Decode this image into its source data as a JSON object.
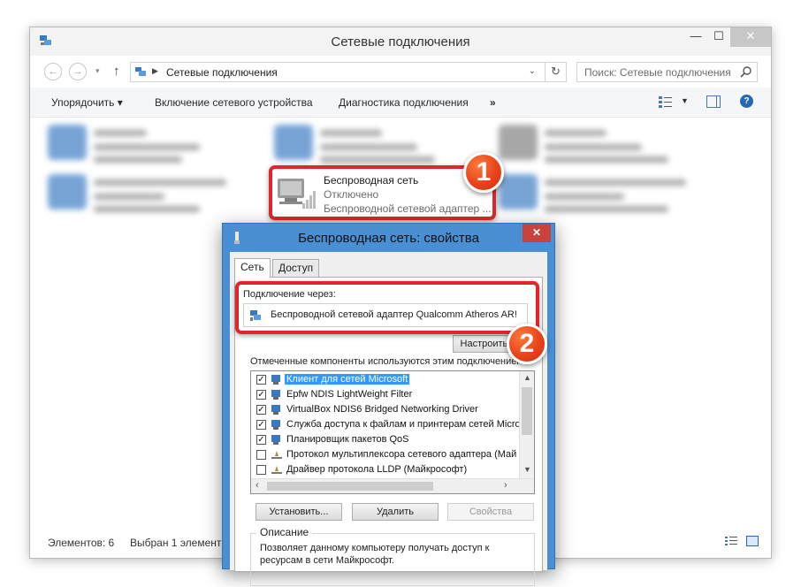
{
  "window": {
    "title": "Сетевые подключения",
    "min": "—",
    "max": "☐",
    "close": "✕"
  },
  "address": {
    "crumb": "Сетевые подключения",
    "search_placeholder": "Поиск: Сетевые подключения"
  },
  "toolbar": {
    "organize": "Упорядочить ▾",
    "enable": "Включение сетевого устройства",
    "diagnostics": "Диагностика подключения",
    "more": "»",
    "help": "?"
  },
  "network_item": {
    "name": "Беспроводная сеть",
    "status": "Отключено",
    "device": "Беспроводной сетевой адаптер ..."
  },
  "statusbar": {
    "count": "Элементов: 6",
    "selected": "Выбран 1 элемент"
  },
  "badges": {
    "one": "1",
    "two": "2"
  },
  "dialog": {
    "title": "Беспроводная сеть: свойства",
    "close": "✕",
    "tabs": [
      "Сеть",
      "Доступ"
    ],
    "connect_via_label": "Подключение через:",
    "adapter_name": "Беспроводной сетевой адаптер Qualcomm Atheros AR!",
    "configure_button": "Настроить...",
    "components_label": "Отмеченные компоненты используются этим подключением:",
    "components": [
      {
        "label": "Клиент для сетей Microsoft",
        "checked": true,
        "selected": true
      },
      {
        "label": "Epfw NDIS LightWeight Filter",
        "checked": true,
        "selected": false
      },
      {
        "label": "VirtualBox NDIS6 Bridged Networking Driver",
        "checked": true,
        "selected": false
      },
      {
        "label": "Служба доступа к файлам и принтерам сетей Micro",
        "checked": true,
        "selected": false
      },
      {
        "label": "Планировщик пакетов QoS",
        "checked": true,
        "selected": false
      },
      {
        "label": "Протокол мультиплексора сетевого адаптера (Май",
        "checked": false,
        "selected": false
      },
      {
        "label": "Драйвер протокола LLDP (Майкрософт)",
        "checked": false,
        "selected": false
      }
    ],
    "install_button": "Установить...",
    "remove_button": "Удалить",
    "properties_button": "Свойства",
    "description_title": "Описание",
    "description_text": "Позволяет данному компьютеру получать доступ к ресурсам в сети Майкрософт."
  }
}
